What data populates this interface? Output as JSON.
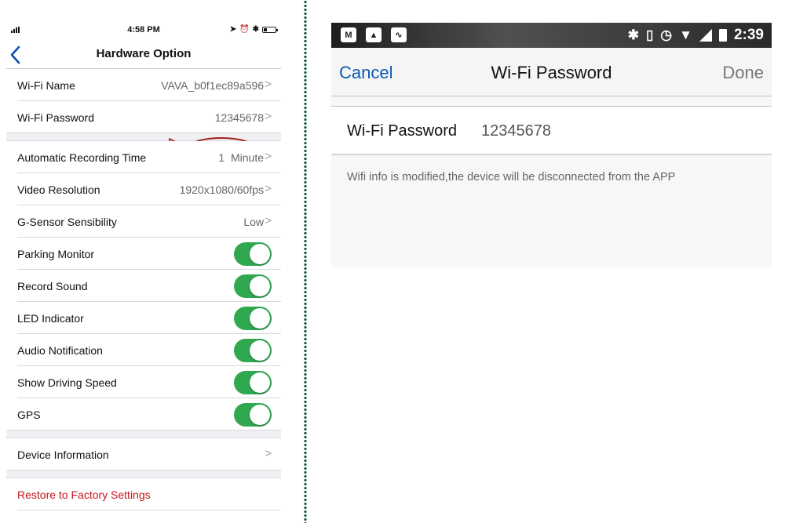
{
  "ios": {
    "status": {
      "time": "4:58 PM"
    },
    "nav": {
      "back_label": "‹",
      "title": "Hardware Option"
    },
    "groups": [
      [
        {
          "label": "Wi-Fi Name",
          "value": "VAVA_b0f1ec89a596",
          "type": "chevron"
        },
        {
          "label": "Wi-Fi Password",
          "value": "12345678",
          "type": "chevron",
          "highlighted": true
        }
      ],
      [
        {
          "label": "Automatic Recording Time",
          "value": "1  Minute",
          "type": "chevron"
        },
        {
          "label": "Video Resolution",
          "value": "1920x1080/60fps",
          "type": "chevron"
        },
        {
          "label": "G-Sensor Sensibility",
          "value": "Low",
          "type": "chevron"
        },
        {
          "label": "Parking Monitor",
          "type": "toggle",
          "on": true
        },
        {
          "label": "Record Sound",
          "type": "toggle",
          "on": true
        },
        {
          "label": "LED Indicator",
          "type": "toggle",
          "on": true
        },
        {
          "label": "Audio Notification",
          "type": "toggle",
          "on": true
        },
        {
          "label": "Show Driving Speed",
          "type": "toggle",
          "on": true
        },
        {
          "label": "GPS",
          "type": "toggle",
          "on": true
        }
      ],
      [
        {
          "label": "Device Information",
          "type": "chevron"
        }
      ],
      [
        {
          "label": "Restore to Factory Settings",
          "type": "destructive"
        }
      ]
    ],
    "toggle_on_color": "#2fa84f",
    "destructive_color": "#c4161c",
    "accent_color": "#0a4fb0"
  },
  "annotation": {
    "color": "#a31f1f",
    "target": "Wi-Fi Password value"
  },
  "android": {
    "status": {
      "time": "2:39",
      "left_icons": [
        "gmail-icon",
        "gallery-icon",
        "activity-icon"
      ],
      "right_icons": [
        "bluetooth-icon",
        "vibrate-icon",
        "alarm-icon",
        "wifi-off-icon",
        "signal-icon",
        "battery-icon"
      ]
    },
    "toolbar": {
      "cancel_label": "Cancel",
      "title": "Wi-Fi Password",
      "done_label": "Done"
    },
    "field": {
      "label": "Wi-Fi Password",
      "value": "12345678"
    },
    "note": "Wifi info is modified,the device will be disconnected from the APP",
    "accent_color": "#0a5bb5"
  }
}
